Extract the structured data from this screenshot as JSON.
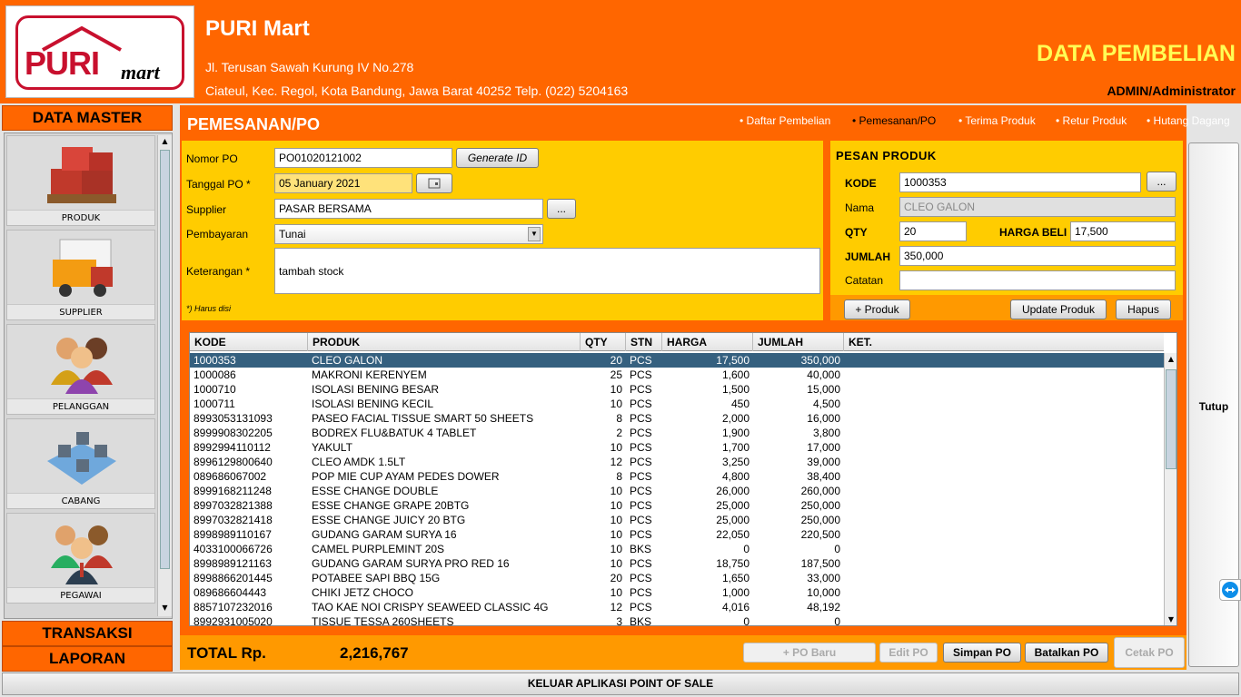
{
  "header": {
    "store_name": "PURI Mart",
    "address_line1": "Jl. Terusan Sawah Kurung IV No.278",
    "address_line2": "Ciateul, Kec. Regol, Kota Bandung, Jawa Barat 40252 Telp. (022) 5204163",
    "page_title": "DATA PEMBELIAN",
    "user": "ADMIN/Administrator",
    "logo_text_main": "PURI",
    "logo_text_sub": "mart"
  },
  "sidebar": {
    "master_title": "DATA MASTER",
    "items": [
      {
        "label": "PRODUK",
        "icon": "boxes-icon"
      },
      {
        "label": "SUPPLIER",
        "icon": "truck-icon"
      },
      {
        "label": "PELANGGAN",
        "icon": "customers-icon"
      },
      {
        "label": "CABANG",
        "icon": "branch-map-icon"
      },
      {
        "label": "PEGAWAI",
        "icon": "employees-icon"
      }
    ],
    "transaksi": "TRANSAKSI",
    "laporan": "LAPORAN"
  },
  "content": {
    "title": "PEMESANAN/PO",
    "nav": [
      "Daftar Pembelian",
      "Pemesanan/PO",
      "Terima Produk",
      "Retur Produk",
      "Hutang Dagang"
    ],
    "nav_active": "Pemesanan/PO"
  },
  "form": {
    "nomor_label": "Nomor  PO",
    "nomor_value": "PO01020121002",
    "generate_label": "Generate ID",
    "tanggal_label": "Tanggal PO *",
    "tanggal_value": "05 January 2021",
    "supplier_label": "Supplier",
    "supplier_value": "PASAR BERSAMA",
    "browse_label": "...",
    "pembayaran_label": "Pembayaran",
    "pembayaran_value": "Tunai",
    "keterangan_label": "Keterangan *",
    "keterangan_value": "tambah stock",
    "required_note": "*) Harus disi"
  },
  "pesan": {
    "title": "PESAN PRODUK",
    "kode_label": "KODE",
    "kode_value": "1000353",
    "nama_label": "Nama",
    "nama_value": "CLEO GALON",
    "qty_label": "QTY",
    "qty_value": "20",
    "harga_label": "HARGA BELI",
    "harga_value": "17,500",
    "jumlah_label": "JUMLAH",
    "jumlah_value": "350,000",
    "catatan_label": "Catatan",
    "catatan_value": "",
    "browse_label": "...",
    "add_label": "+ Produk",
    "update_label": "Update Produk",
    "hapus_label": "Hapus"
  },
  "table": {
    "columns": [
      "KODE",
      "PRODUK",
      "QTY",
      "STN",
      "HARGA",
      "JUMLAH",
      "KET."
    ],
    "rows": [
      [
        "1000353",
        "CLEO GALON",
        "20",
        "PCS",
        "17,500",
        "350,000",
        ""
      ],
      [
        "1000086",
        "MAKRONI KERENYEM",
        "25",
        "PCS",
        "1,600",
        "40,000",
        ""
      ],
      [
        "1000710",
        "ISOLASI BENING BESAR",
        "10",
        "PCS",
        "1,500",
        "15,000",
        ""
      ],
      [
        "1000711",
        "ISOLASI BENING KECIL",
        "10",
        "PCS",
        "450",
        "4,500",
        ""
      ],
      [
        "8993053131093",
        "PASEO FACIAL TISSUE SMART 50 SHEETS",
        "8",
        "PCS",
        "2,000",
        "16,000",
        ""
      ],
      [
        "8999908302205",
        "BODREX FLU&BATUK 4 TABLET",
        "2",
        "PCS",
        "1,900",
        "3,800",
        ""
      ],
      [
        "8992994110112",
        "YAKULT",
        "10",
        "PCS",
        "1,700",
        "17,000",
        ""
      ],
      [
        "8996129800640",
        "CLEO AMDK 1.5LT",
        "12",
        "PCS",
        "3,250",
        "39,000",
        ""
      ],
      [
        "089686067002",
        "POP MIE CUP AYAM PEDES DOWER",
        "8",
        "PCS",
        "4,800",
        "38,400",
        ""
      ],
      [
        "8999168211248",
        "ESSE CHANGE DOUBLE",
        "10",
        "PCS",
        "26,000",
        "260,000",
        ""
      ],
      [
        "8997032821388",
        "ESSE CHANGE GRAPE 20BTG",
        "10",
        "PCS",
        "25,000",
        "250,000",
        ""
      ],
      [
        "8997032821418",
        "ESSE CHANGE JUICY 20 BTG",
        "10",
        "PCS",
        "25,000",
        "250,000",
        ""
      ],
      [
        "8998989110167",
        "GUDANG GARAM SURYA 16",
        "10",
        "PCS",
        "22,050",
        "220,500",
        ""
      ],
      [
        "4033100066726",
        "CAMEL PURPLEMINT  20S",
        "10",
        "BKS",
        "0",
        "0",
        ""
      ],
      [
        "8998989121163",
        "GUDANG GARAM SURYA PRO RED 16",
        "10",
        "PCS",
        "18,750",
        "187,500",
        ""
      ],
      [
        "8998866201445",
        "POTABEE SAPI BBQ 15G",
        "20",
        "PCS",
        "1,650",
        "33,000",
        ""
      ],
      [
        "089686604443",
        "CHIKI JETZ CHOCO",
        "10",
        "PCS",
        "1,000",
        "10,000",
        ""
      ],
      [
        "8857107232016",
        "TAO KAE NOI CRISPY SEAWEED CLASSIC 4G",
        "12",
        "PCS",
        "4,016",
        "48,192",
        ""
      ],
      [
        "8992931005020",
        "TISSUE TESSA 260SHEETS",
        "3",
        "BKS",
        "0",
        "0",
        ""
      ]
    ],
    "selected_row": 0
  },
  "footer": {
    "total_label": "TOTAL  Rp.",
    "total_value": "2,216,767",
    "po_baru": "+ PO Baru",
    "edit_po": "Edit PO",
    "simpan_po": "Simpan PO",
    "batalkan_po": "Batalkan PO",
    "cetak_po": "Cetak PO",
    "tutup": "Tutup",
    "exit": "KELUAR APLIKASI POINT OF SALE"
  },
  "colors": {
    "brand_orange": "#ff6600",
    "panel_yellow": "#ffcc00",
    "title_yellow": "#ffff55",
    "selection_blue": "#35607f",
    "logo_red": "#c8102e"
  }
}
